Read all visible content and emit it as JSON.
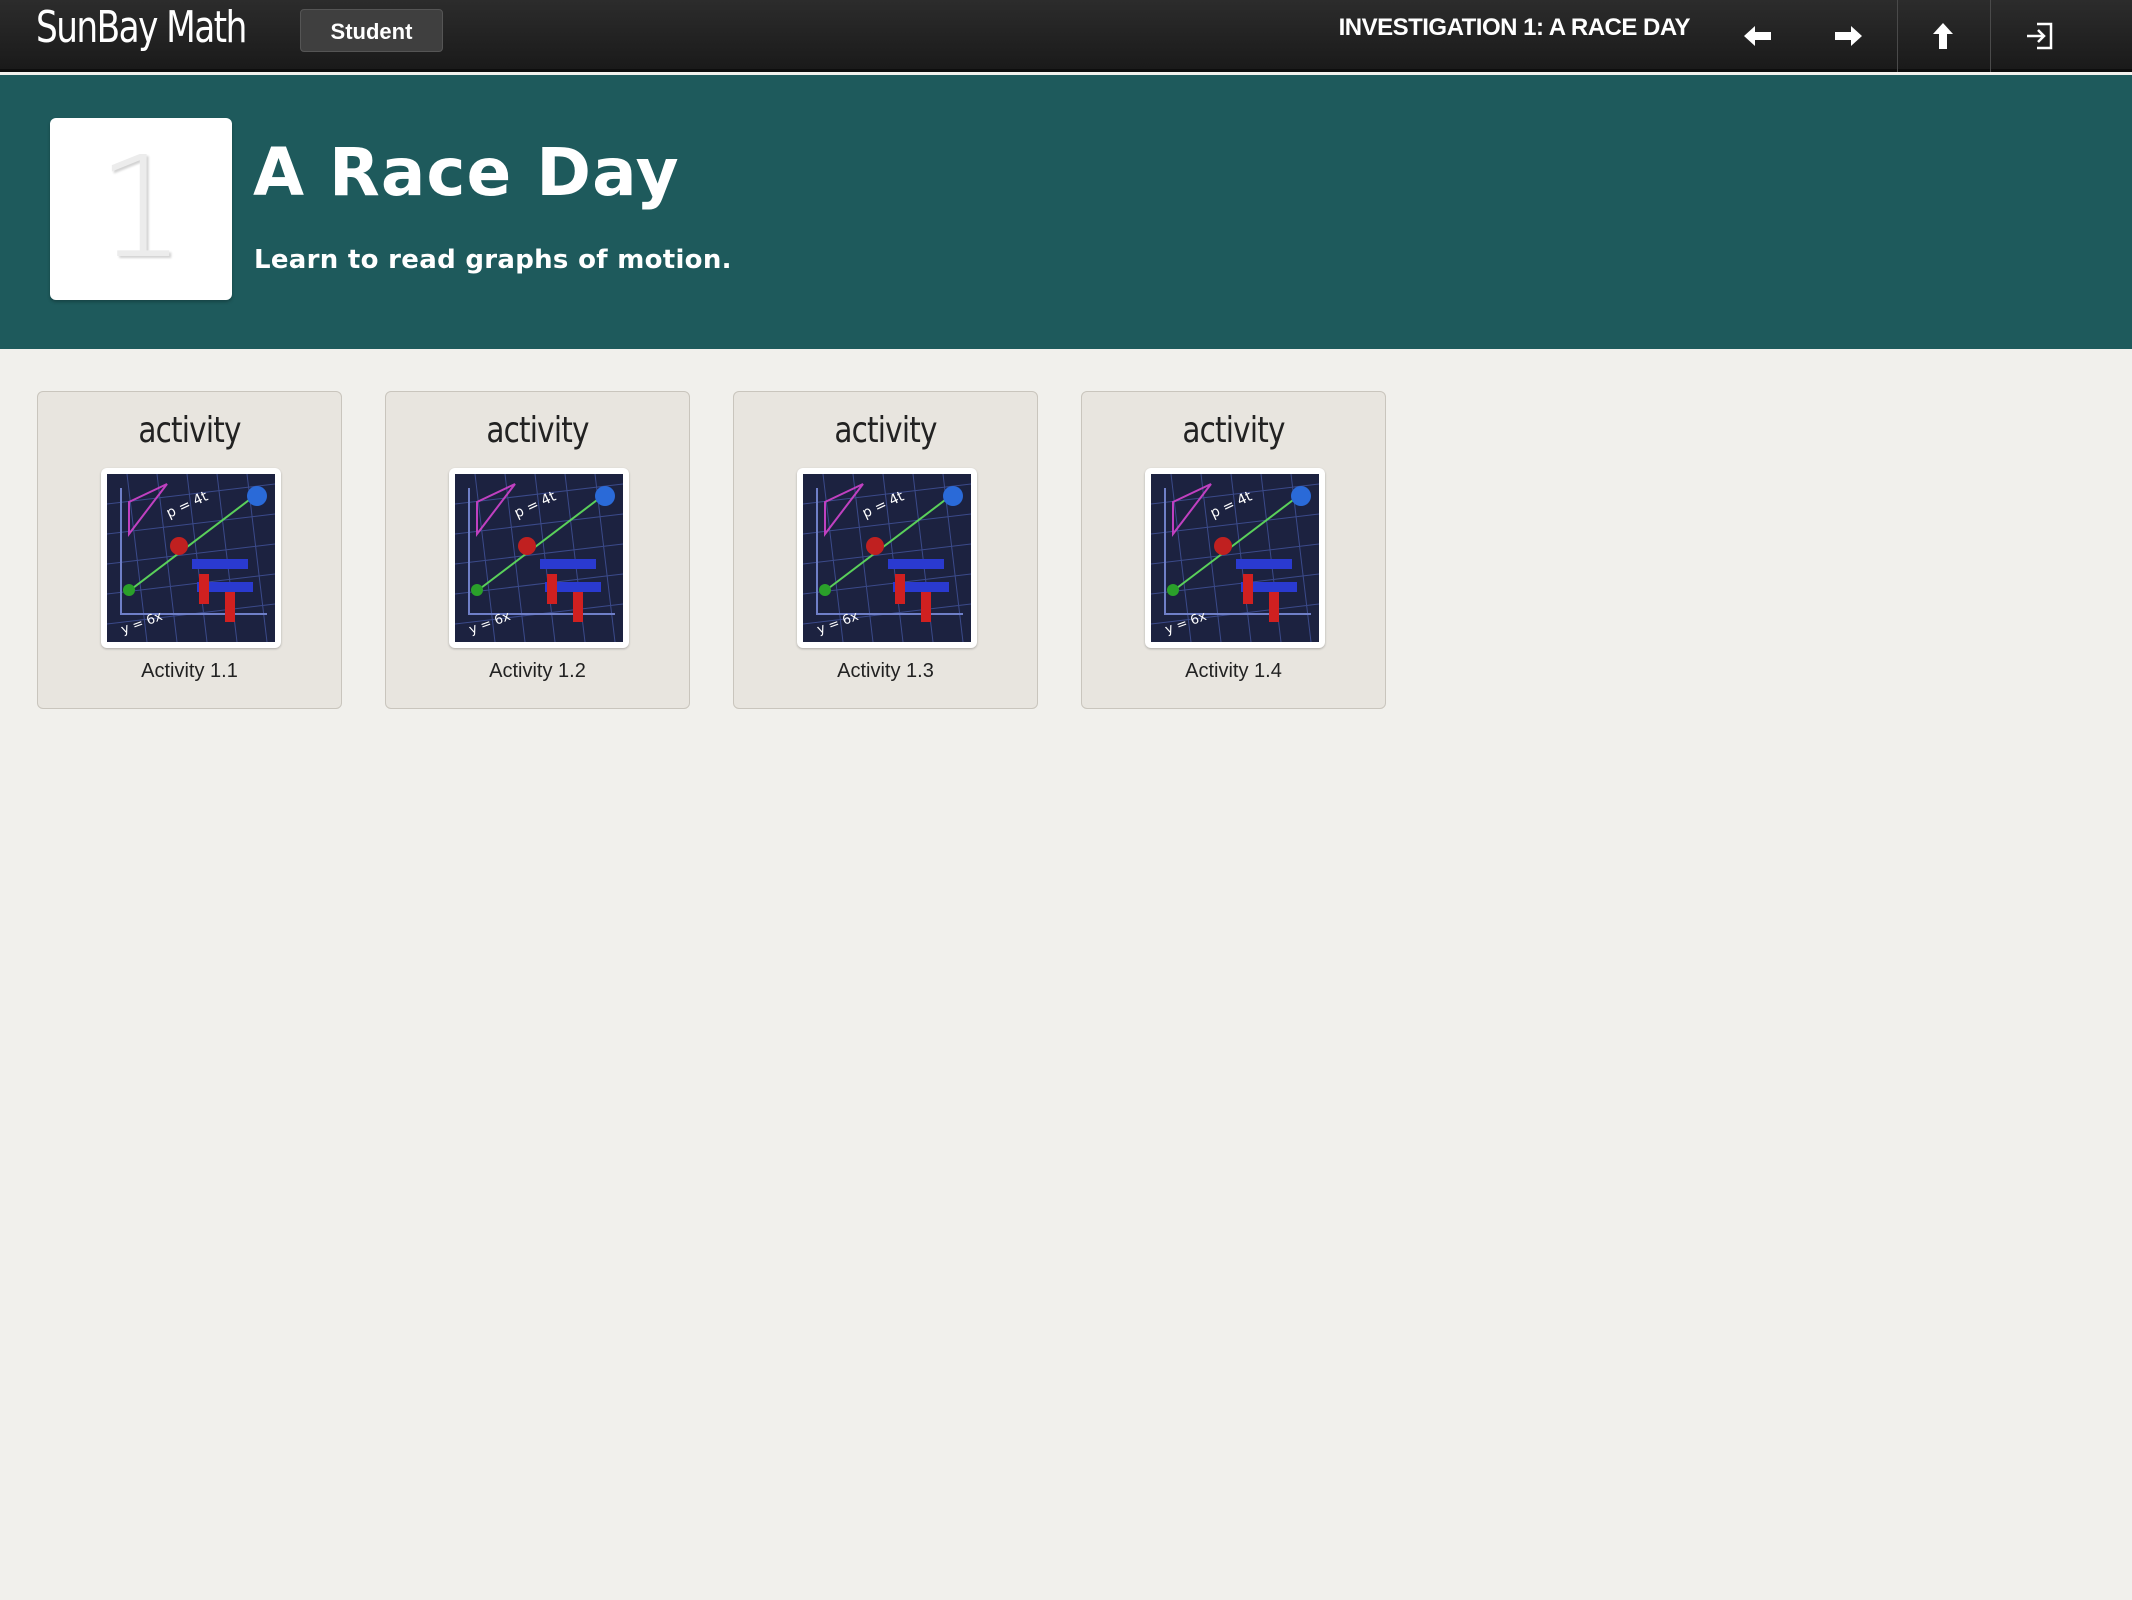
{
  "app": {
    "brand": "SunBay Math",
    "role": "Student"
  },
  "header": {
    "title": "INVESTIGATION 1: A RACE DAY",
    "nav": {
      "back_icon": "arrow-left-icon",
      "forward_icon": "arrow-right-icon",
      "up_icon": "arrow-up-icon",
      "exit_icon": "sign-out-icon"
    }
  },
  "investigation": {
    "number": "1",
    "title": "A Race Day",
    "subtitle": "Learn to read graphs of motion.",
    "banner_color": "#1e5a5c"
  },
  "activities": [
    {
      "type": "activity",
      "label": "Activity 1.1",
      "thumbnail": "race-graph-thumbnail",
      "thumb_texts": [
        "p = 4t",
        "y = 6x"
      ]
    },
    {
      "type": "activity",
      "label": "Activity 1.2",
      "thumbnail": "race-graph-thumbnail",
      "thumb_texts": [
        "p = 4t",
        "y = 6x"
      ]
    },
    {
      "type": "activity",
      "label": "Activity 1.3",
      "thumbnail": "race-graph-thumbnail",
      "thumb_texts": [
        "p = 4t",
        "y = 6x"
      ]
    },
    {
      "type": "activity",
      "label": "Activity 1.4",
      "thumbnail": "race-graph-thumbnail",
      "thumb_texts": [
        "p = 4t",
        "y = 6x"
      ]
    }
  ]
}
